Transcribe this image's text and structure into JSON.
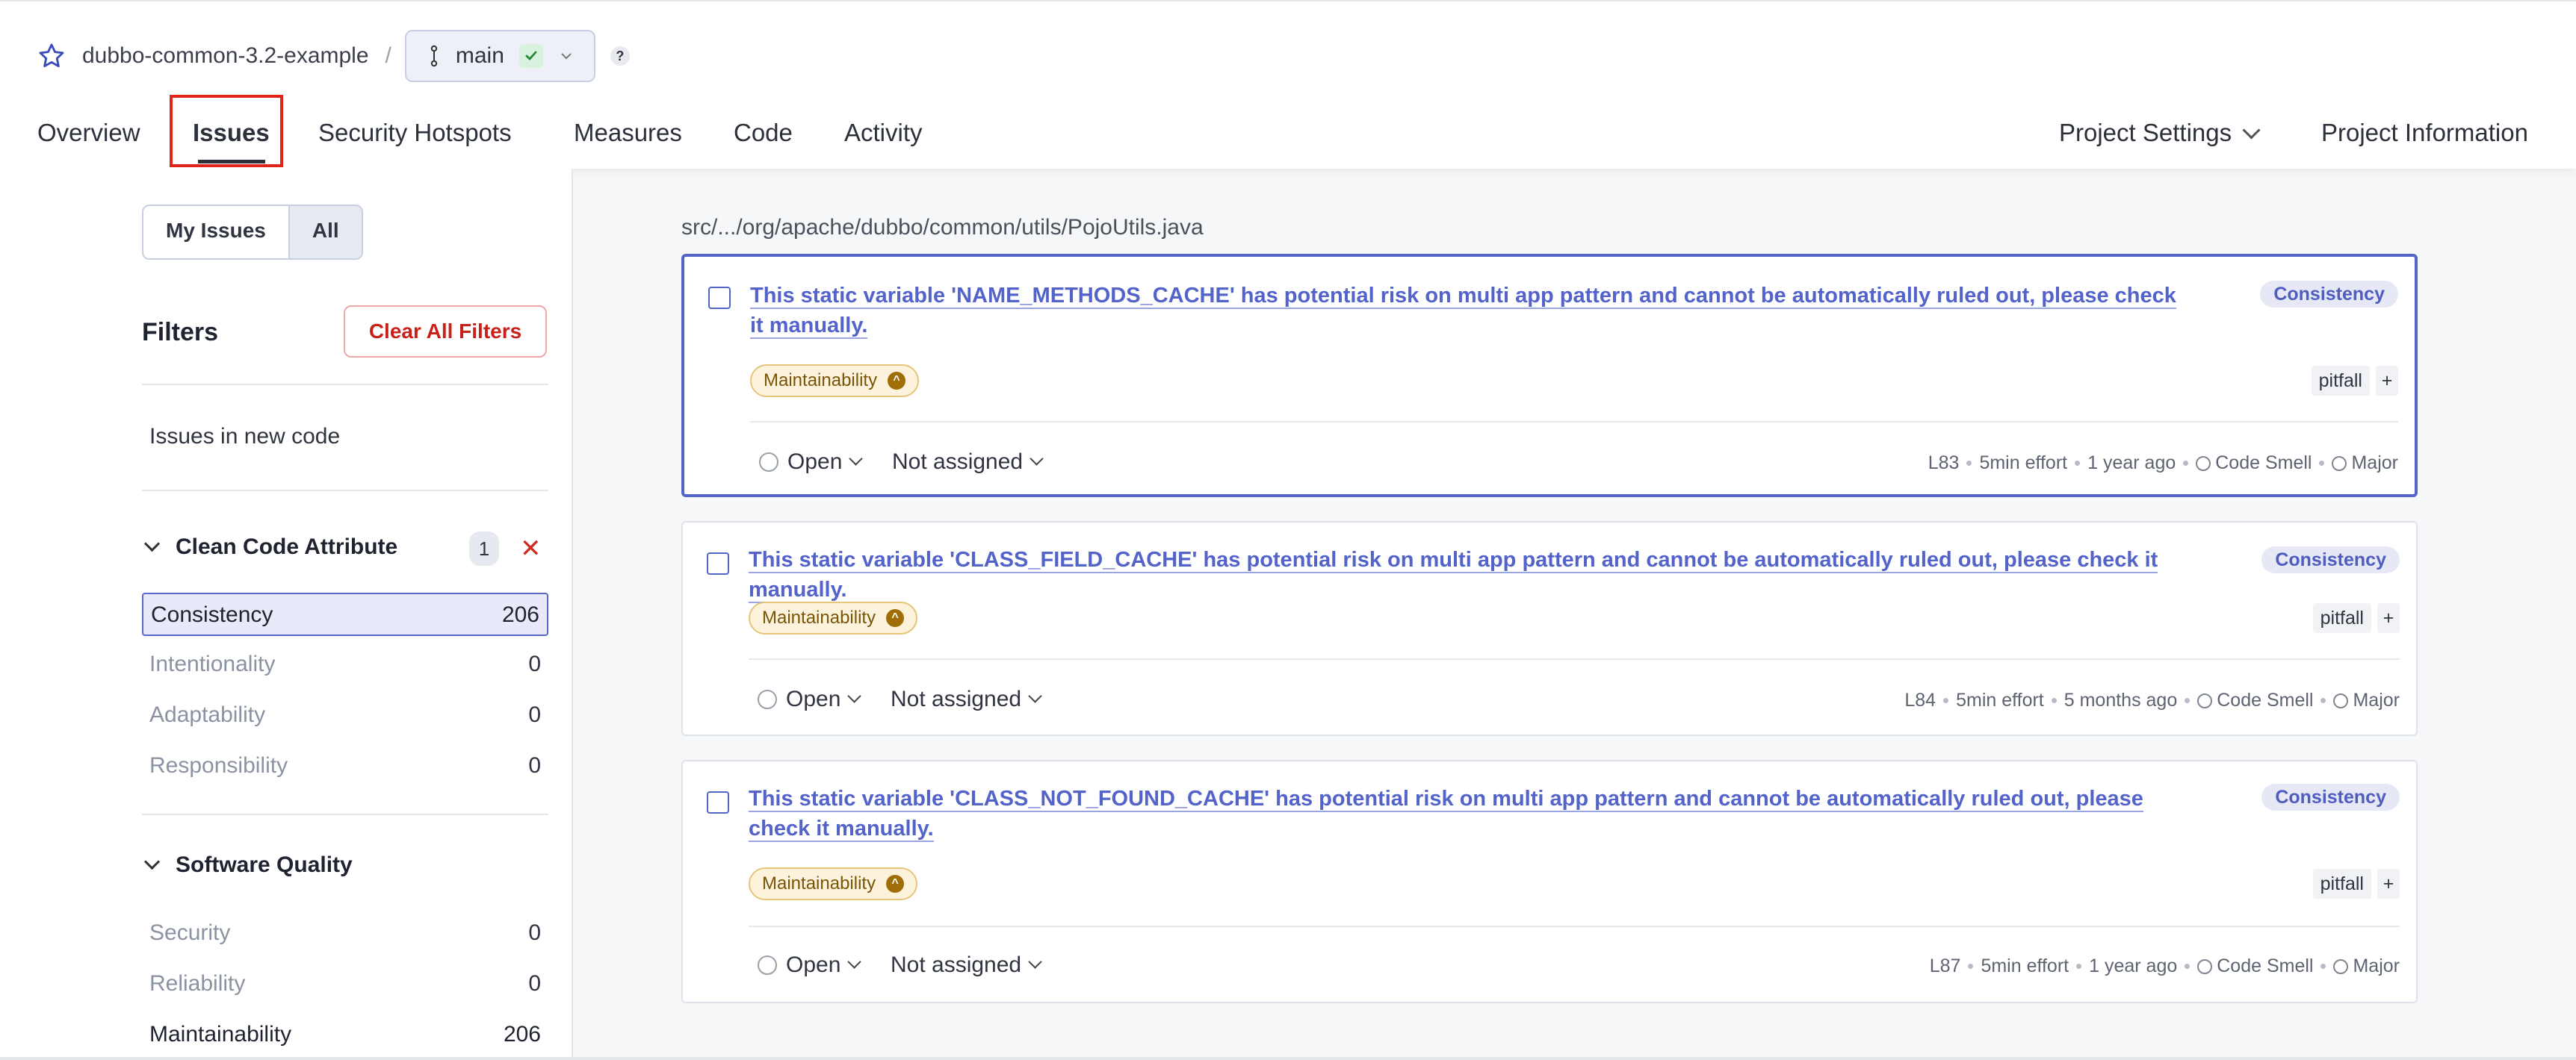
{
  "project": {
    "name": "dubbo-common-3.2-example",
    "separator": "/",
    "branch": "main",
    "help": "?"
  },
  "nav": {
    "items": [
      "Overview",
      "Issues",
      "Security Hotspots",
      "Measures",
      "Code",
      "Activity"
    ],
    "right": [
      "Project Settings",
      "Project Information"
    ]
  },
  "sidebar": {
    "toggle": [
      "My Issues",
      "All"
    ],
    "filters_title": "Filters",
    "clear_all": "Clear All Filters",
    "new_code": "Issues in new code",
    "clean_code": {
      "title": "Clean Code Attribute",
      "badge": "1",
      "items": [
        {
          "label": "Consistency",
          "count": "206"
        },
        {
          "label": "Intentionality",
          "count": "0"
        },
        {
          "label": "Adaptability",
          "count": "0"
        },
        {
          "label": "Responsibility",
          "count": "0"
        }
      ]
    },
    "software_quality": {
      "title": "Software Quality",
      "items": [
        {
          "label": "Security",
          "count": "0"
        },
        {
          "label": "Reliability",
          "count": "0"
        },
        {
          "label": "Maintainability",
          "count": "206"
        }
      ]
    }
  },
  "file_path": "src/.../org/apache/dubbo/common/utils/PojoUtils.java",
  "issues": [
    {
      "title": "This static variable 'NAME_METHODS_CACHE' has potential risk on multi app pattern and cannot be automatically ruled out, please check it manually.",
      "attribute": "Consistency",
      "quality": "Maintainability",
      "tag": "pitfall",
      "plus": "+",
      "status": "Open",
      "assignee": "Not assigned",
      "line": "L83",
      "effort": "5min effort",
      "age": "1 year ago",
      "type": "Code Smell",
      "severity": "Major"
    },
    {
      "title": "This static variable 'CLASS_FIELD_CACHE' has potential risk on multi app pattern and cannot be automatically ruled out, please check it manually.",
      "attribute": "Consistency",
      "quality": "Maintainability",
      "tag": "pitfall",
      "plus": "+",
      "status": "Open",
      "assignee": "Not assigned",
      "line": "L84",
      "effort": "5min effort",
      "age": "5 months ago",
      "type": "Code Smell",
      "severity": "Major"
    },
    {
      "title": "This static variable 'CLASS_NOT_FOUND_CACHE' has potential risk on multi app pattern and cannot be automatically ruled out, please check it manually.",
      "attribute": "Consistency",
      "quality": "Maintainability",
      "tag": "pitfall",
      "plus": "+",
      "status": "Open",
      "assignee": "Not assigned",
      "line": "L87",
      "effort": "5min effort",
      "age": "1 year ago",
      "type": "Code Smell",
      "severity": "Major"
    }
  ]
}
